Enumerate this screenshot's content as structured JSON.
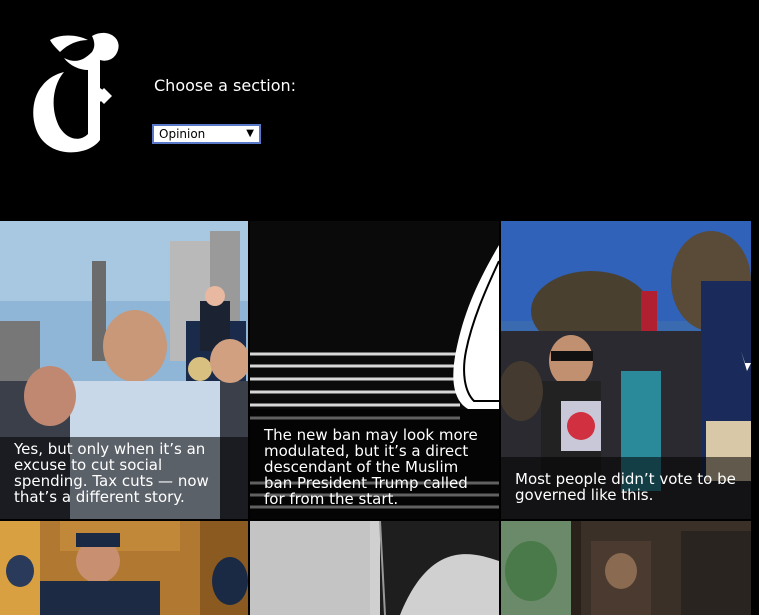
{
  "header": {
    "logo": "nyt-t-logo",
    "section_label": "Choose a section:",
    "section_select": {
      "selected": "Opinion"
    }
  },
  "tiles": [
    {
      "caption": "Yes, but only when it’s an excuse to cut social spending. Tax cuts — now that’s a different story."
    },
    {
      "caption": "The new ban may look more modulated, but it’s a direct descendant of the Muslim ban President Trump called for from the start."
    },
    {
      "caption": "Most people didn’t vote to be governed like this."
    }
  ]
}
